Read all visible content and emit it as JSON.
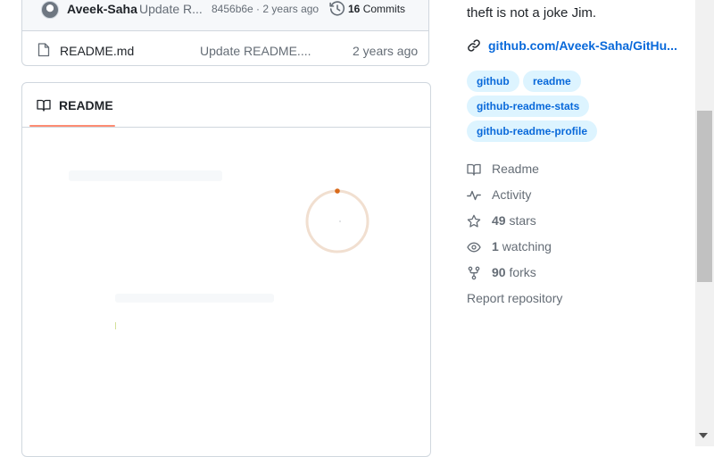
{
  "last_commit": {
    "author": "Aveek-Saha",
    "message": "Update R...",
    "meta": "8456b6e · 2 years ago",
    "commits_count": "16",
    "commits_label": "Commits"
  },
  "files": [
    {
      "name": "README.md",
      "commit": "Update README....",
      "age": "2 years ago",
      "icon": "file-icon"
    }
  ],
  "readme": {
    "tab_label": "README",
    "tab_icon": "book-icon",
    "loading": true
  },
  "about": {
    "description": "theft is not a joke Jim.",
    "link_text": "github.com/Aveek-Saha/GitHu...",
    "topics": [
      "github",
      "readme",
      "github-readme-stats",
      "github-readme-profile"
    ],
    "stats": {
      "readme_label": "Readme",
      "activity_label": "Activity",
      "stars_count": "49",
      "stars_label": "stars",
      "watching_count": "1",
      "watching_label": "watching",
      "forks_count": "90",
      "forks_label": "forks"
    },
    "report_label": "Report repository"
  },
  "colors": {
    "accent_link": "#0969da",
    "topic_bg": "#ddf4ff",
    "tab_underline": "#fd8c73",
    "spinner": "#d96a1a",
    "border": "#d0d7de"
  }
}
